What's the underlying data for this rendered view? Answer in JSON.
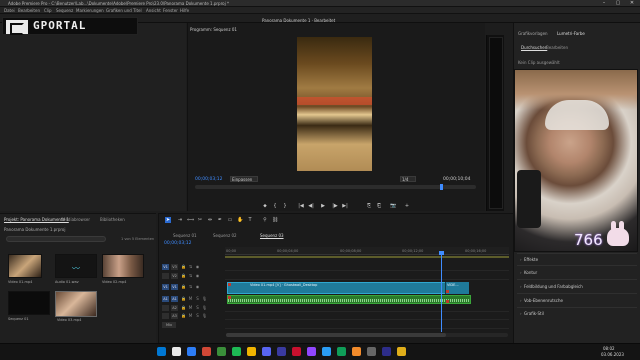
{
  "titlebar": {
    "title": "Adobe Premiere Pro - C:\\Benutzer\\Lab...\\Dokumente\\Adobe\\Premiere Pro\\23.0\\Panorama Dokumente 1.prproj *",
    "minimize": "–",
    "maximize": "▢",
    "close": "✕"
  },
  "menubar": {
    "items": [
      "Datei",
      "Bearbeiten",
      "Clip",
      "Sequenz",
      "Markierungen",
      "Grafiken und Titel",
      "Ansicht",
      "Fenster",
      "Hilfe"
    ]
  },
  "workspace": {
    "title": "Panorama Dokumente 1 · Bearbeitet"
  },
  "overlay": {
    "brand": "GPORTAL"
  },
  "program_monitor": {
    "tab_label": "Programm: Sequenz 01",
    "sequence_label": "Sequenz 01",
    "timecode_current": "00;00;03;12",
    "fit_option": "Einpassen",
    "quality_option": "1/4",
    "timecode_duration": "00;00;10;04",
    "transport": [
      "⬥",
      "{",
      "}",
      "|◀",
      "◀|",
      "▶",
      "|▶",
      "▶|",
      "⎘",
      "⎗",
      "📷",
      "+"
    ]
  },
  "right_panel": {
    "tabs": [
      {
        "label": "Grafikvorlagen",
        "active": false
      },
      {
        "label": "Lumetri-Farbe",
        "active": true
      }
    ],
    "subtabs": [
      {
        "label": "Durchsuchen",
        "active": true
      },
      {
        "label": "Bearbeiten",
        "active": false
      }
    ],
    "hint": "Kein Clip ausgewählt",
    "sections": [
      "Effekte",
      "Kontur",
      "Feldbildung und Farbabgleich",
      "Vob-Ebenenrutsche",
      "Grafik-Stil"
    ]
  },
  "webcam": {
    "follower_count": "766"
  },
  "project_panel": {
    "tabs": [
      {
        "label": "Projekt: Panorama Dokumente 1",
        "active": true
      },
      {
        "label": "Mediabrowser",
        "active": false
      },
      {
        "label": "Bibliotheken",
        "active": false
      }
    ],
    "path": "Panorama Dokumente 1.prproj",
    "item_count": "1 von 5 Elementen",
    "items": [
      {
        "label": "Video 01.mp4",
        "duration": "0:10"
      },
      {
        "label": "Audio 01.wav",
        "duration": "1:01"
      },
      {
        "label": "Video 02.mp4",
        "duration": "12:04"
      },
      {
        "label": "Sequenz 01",
        "duration": "10:04"
      },
      {
        "label": "Video 03.mp4",
        "duration": "10:04"
      }
    ]
  },
  "timeline": {
    "sequence_tabs": [
      {
        "label": "Sequenz 01",
        "active": false
      },
      {
        "label": "Sequenz 02",
        "active": false
      },
      {
        "label": "Sequenz 03",
        "active": true
      }
    ],
    "timecode": "00;00;03;12",
    "ruler_labels": [
      "00;00",
      "00;00;04;00",
      "00;00;08;00",
      "00;00;12;00",
      "00;00;16;00"
    ],
    "tracks": [
      {
        "id": "V3",
        "source": "V1"
      },
      {
        "id": "V2",
        "source": ""
      },
      {
        "id": "V1",
        "source": "V1"
      },
      {
        "id": "A1",
        "source": "A1"
      },
      {
        "id": "A2",
        "source": ""
      },
      {
        "id": "A3",
        "source": ""
      },
      {
        "id": "Mix",
        "source": ""
      }
    ],
    "clips": {
      "video_main": "Video 01.mp4 [V] · Ghostwall_Desktop",
      "video_end": "VIDE..."
    }
  },
  "taskbar": {
    "time": "08:02",
    "date": "03.06.2023",
    "apps": [
      "#0078d4",
      "#e9e9e9",
      "#2d7df6",
      "#d14836",
      "#3a8f3a",
      "#1db954",
      "#f0b400",
      "#5865f2",
      "#3a3aa0",
      "#c8102e",
      "#9146ff",
      "#2a9df4",
      "#0f9d58",
      "#f28b2b",
      "#666666",
      "#2d2d8a",
      "#e0ae1a"
    ]
  }
}
